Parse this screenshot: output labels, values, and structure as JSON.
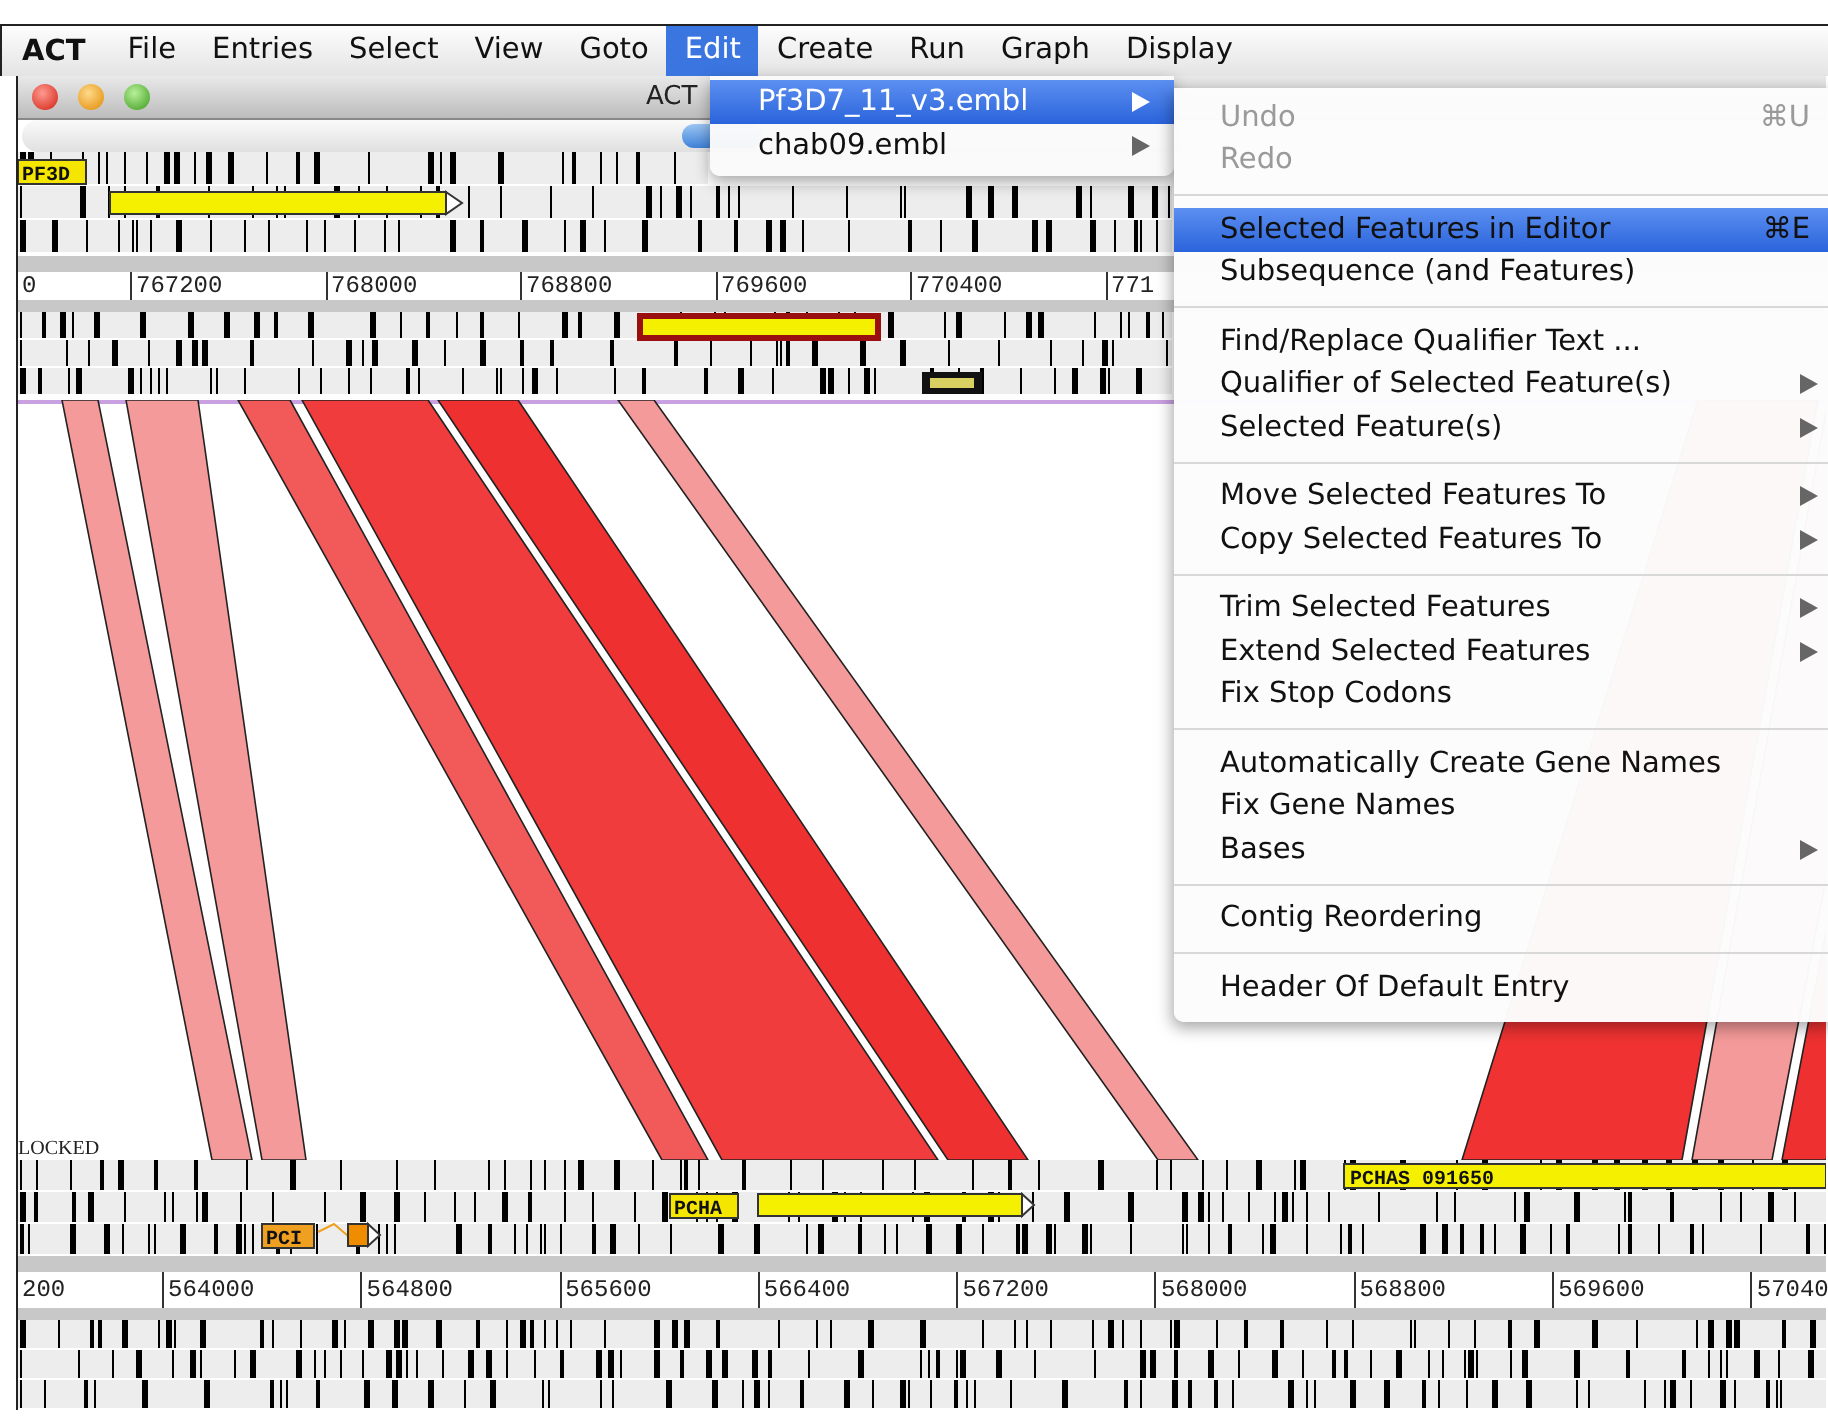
{
  "menubar": {
    "app": "ACT",
    "items": [
      {
        "label": "File",
        "selected": false
      },
      {
        "label": "Entries",
        "selected": false
      },
      {
        "label": "Select",
        "selected": false
      },
      {
        "label": "View",
        "selected": false
      },
      {
        "label": "Goto",
        "selected": false
      },
      {
        "label": "Edit",
        "selected": true
      },
      {
        "label": "Create",
        "selected": false
      },
      {
        "label": "Run",
        "selected": false
      },
      {
        "label": "Graph",
        "selected": false
      },
      {
        "label": "Display",
        "selected": false
      }
    ]
  },
  "window": {
    "title": "ACT"
  },
  "top_sequence": {
    "feature_label": "PF3D",
    "ruler": [
      "0",
      "767200",
      "768000",
      "768800",
      "769600",
      "770400",
      "771"
    ]
  },
  "bottom_sequence": {
    "status": "LOCKED",
    "feature_labels": [
      "PCI",
      "PCHA",
      "PCHAS 091650"
    ],
    "ruler": [
      "200",
      "564000",
      "564800",
      "565600",
      "566400",
      "567200",
      "568000",
      "568800",
      "569600",
      "57040"
    ]
  },
  "edit_menu": [
    {
      "label": "Pf3D7_11_v3.embl",
      "selected": true,
      "submenu": true
    },
    {
      "label": "chab09.embl",
      "selected": false,
      "submenu": true
    }
  ],
  "entry_submenu": [
    [
      {
        "label": "Undo",
        "shortcut": "⌘U",
        "disabled": true,
        "selected": false,
        "submenu": false
      },
      {
        "label": "Redo",
        "disabled": true,
        "selected": false,
        "submenu": false
      }
    ],
    [
      {
        "label": "Selected Features in Editor",
        "shortcut": "⌘E",
        "disabled": false,
        "selected": true,
        "submenu": false
      },
      {
        "label": "Subsequence (and Features)",
        "disabled": false,
        "selected": false,
        "submenu": false
      }
    ],
    [
      {
        "label": "Find/Replace Qualifier Text ...",
        "disabled": false,
        "selected": false,
        "submenu": false
      },
      {
        "label": "Qualifier of Selected Feature(s)",
        "disabled": false,
        "selected": false,
        "submenu": true
      },
      {
        "label": "Selected Feature(s)",
        "disabled": false,
        "selected": false,
        "submenu": true
      }
    ],
    [
      {
        "label": "Move Selected Features To",
        "disabled": false,
        "selected": false,
        "submenu": true
      },
      {
        "label": "Copy Selected Features To",
        "disabled": false,
        "selected": false,
        "submenu": true
      }
    ],
    [
      {
        "label": "Trim Selected Features",
        "disabled": false,
        "selected": false,
        "submenu": true
      },
      {
        "label": "Extend Selected Features",
        "disabled": false,
        "selected": false,
        "submenu": true
      },
      {
        "label": "Fix Stop Codons",
        "disabled": false,
        "selected": false,
        "submenu": false
      }
    ],
    [
      {
        "label": "Automatically Create Gene Names",
        "disabled": false,
        "selected": false,
        "submenu": false
      },
      {
        "label": "Fix Gene Names",
        "disabled": false,
        "selected": false,
        "submenu": false
      },
      {
        "label": "Bases",
        "disabled": false,
        "selected": false,
        "submenu": true
      }
    ],
    [
      {
        "label": "Contig Reordering",
        "disabled": false,
        "selected": false,
        "submenu": false
      }
    ],
    [
      {
        "label": "Header Of Default Entry",
        "disabled": false,
        "selected": false,
        "submenu": false
      }
    ]
  ]
}
